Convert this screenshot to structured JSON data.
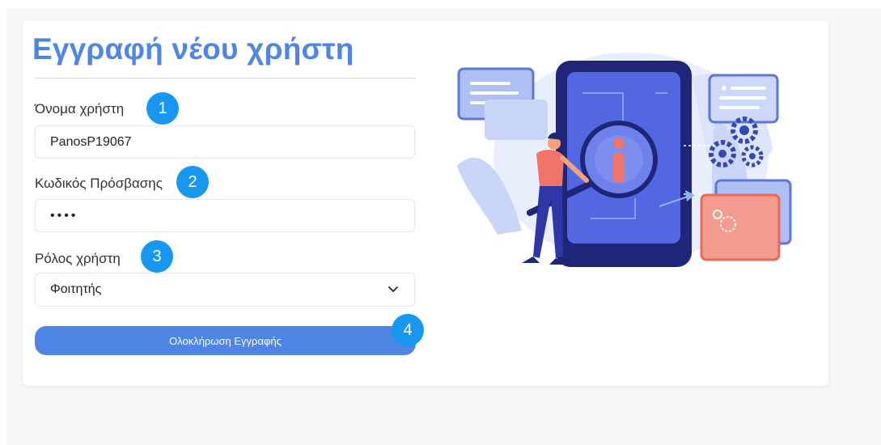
{
  "form": {
    "title": "Εγγραφή νέου χρήστη",
    "username_label": "Όνομα χρήστη",
    "username_value": "PanosP19067",
    "password_label": "Κωδικός Πρόσβασης",
    "password_value": "••••",
    "role_label": "Ρόλος χρήστη",
    "role_selected": "Φοιτητής",
    "submit_label": "Ολοκλήρωση Εγγραφής"
  },
  "badges": [
    "1",
    "2",
    "3",
    "4"
  ],
  "colors": {
    "accent": "#4f86e6",
    "badge": "#1797f0",
    "background": "#f6f7f9"
  },
  "icons": {
    "select_arrow": "chevron-down-icon",
    "illustration": "info-magnifier-illustration"
  }
}
